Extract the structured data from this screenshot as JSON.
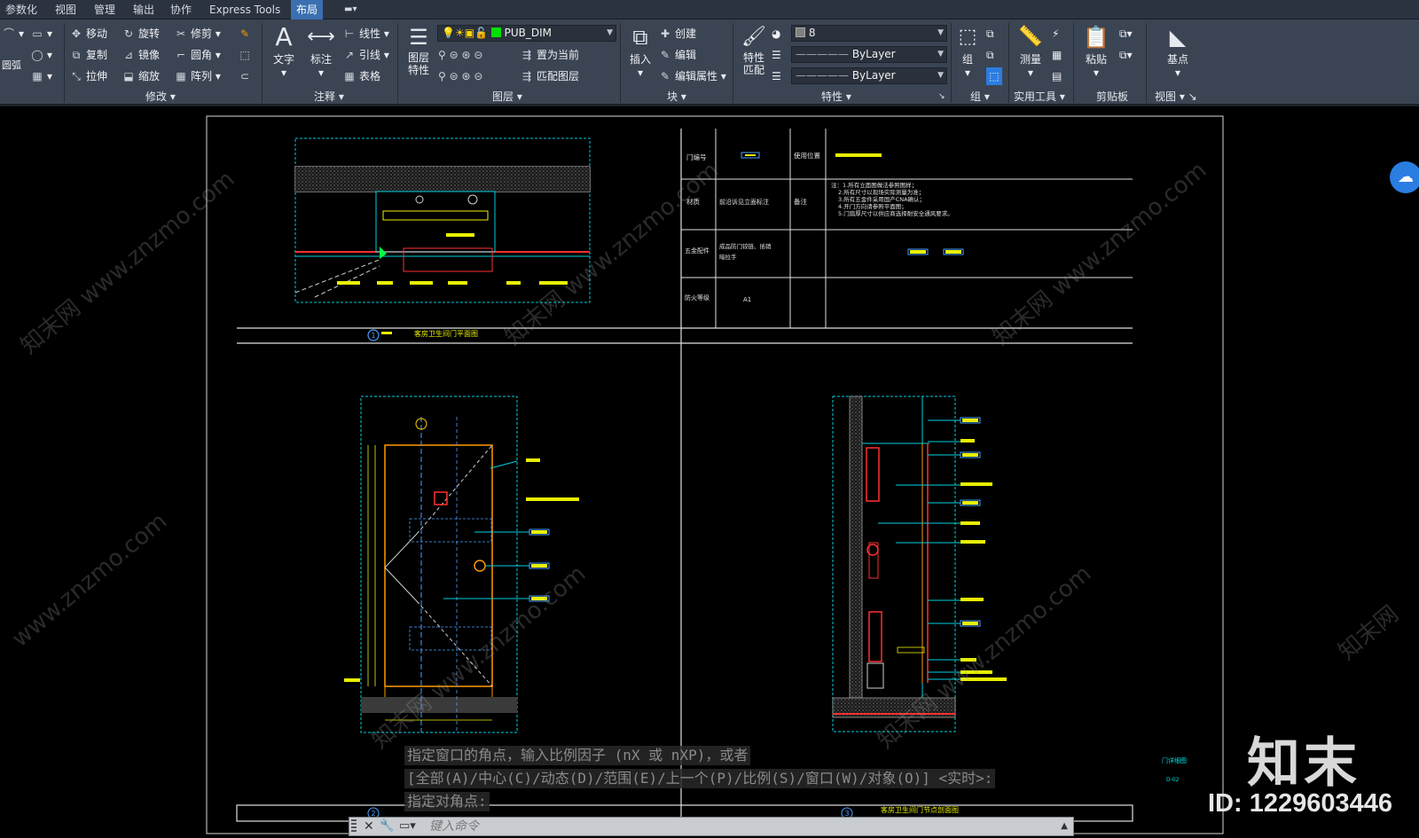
{
  "menubar": {
    "items": [
      "参数化",
      "视图",
      "管理",
      "输出",
      "协作",
      "Express Tools",
      "布局"
    ],
    "active": "布局"
  },
  "ribbon": {
    "draw": {
      "arc_label": "圆弧"
    },
    "modify": {
      "title": "修改",
      "move": "移动",
      "rotate": "旋转",
      "trim": "修剪",
      "copy": "复制",
      "mirror": "镜像",
      "fillet": "圆角",
      "stretch": "拉伸",
      "scale": "缩放",
      "array": "阵列"
    },
    "annotation": {
      "title": "注释",
      "text": "文字",
      "dimension": "标注",
      "linear": "线性",
      "leader": "引线",
      "table": "表格"
    },
    "layers": {
      "title": "图层",
      "layer_props": "图层\n特性",
      "current_layer": "PUB_DIM",
      "set_current": "置为当前",
      "match_layer": "匹配图层"
    },
    "block": {
      "title": "块",
      "insert": "插入",
      "create": "创建",
      "edit": "编辑",
      "edit_attr": "编辑属性"
    },
    "properties": {
      "title": "特性",
      "match": "特性\n匹配",
      "color": "8",
      "linetype": "ByLayer",
      "lineweight": "ByLayer"
    },
    "groups": {
      "title": "组",
      "group": "组"
    },
    "utilities": {
      "title": "实用工具",
      "measure": "测量"
    },
    "clipboard": {
      "title": "剪贴板",
      "paste": "粘贴"
    },
    "view": {
      "title": "视图",
      "base": "基点"
    }
  },
  "drawing": {
    "table": {
      "door_no_label": "门编号",
      "usage_label": "使用位置",
      "material_label": "材质",
      "material_value": "前沿诉见立面标注",
      "remark_label": "备注",
      "notes": [
        "注：1.所有立面图做法参照图样；",
        "2.所有尺寸以现场实际测量为准；",
        "3.所有五金件采用国产CNA确认；",
        "4.开门方向请参照平面图；",
        "5.门扇厚尺寸以供应商选择耐安全通风要求。"
      ],
      "hardware_label": "五金配件",
      "hardware_value": "成品防门铰链、插销\n暗拉手",
      "fire_label": "防火等级",
      "fire_value": "A1"
    },
    "plan_title": "客房卫生间门平面图",
    "plan_no": "1",
    "elev_no": "2",
    "section_no": "3",
    "section_title": "客房卫生间门节点剖面图",
    "frame_tag": "门详细图",
    "frame_sub": "D-02"
  },
  "command": {
    "history": [
      "指定窗口的角点，输入比例因子 (nX 或 nXP)，或者",
      "[全部(A)/中心(C)/动态(D)/范围(E)/上一个(P)/比例(S)/窗口(W)/对象(O)] <实时>:",
      "指定对角点:"
    ],
    "placeholder": "键入命令"
  },
  "watermark": {
    "site": "www.znzmo.com",
    "brand": "知末网",
    "logo": "知末",
    "id": "ID: 1229603446"
  },
  "colors": {
    "ribbon": "#3b4453",
    "menubar": "#2c3340",
    "canvas": "#000000",
    "cyan": "#00d0e0",
    "yellow": "#e8f000",
    "red": "#ff3030",
    "orange": "#ff9a00"
  }
}
